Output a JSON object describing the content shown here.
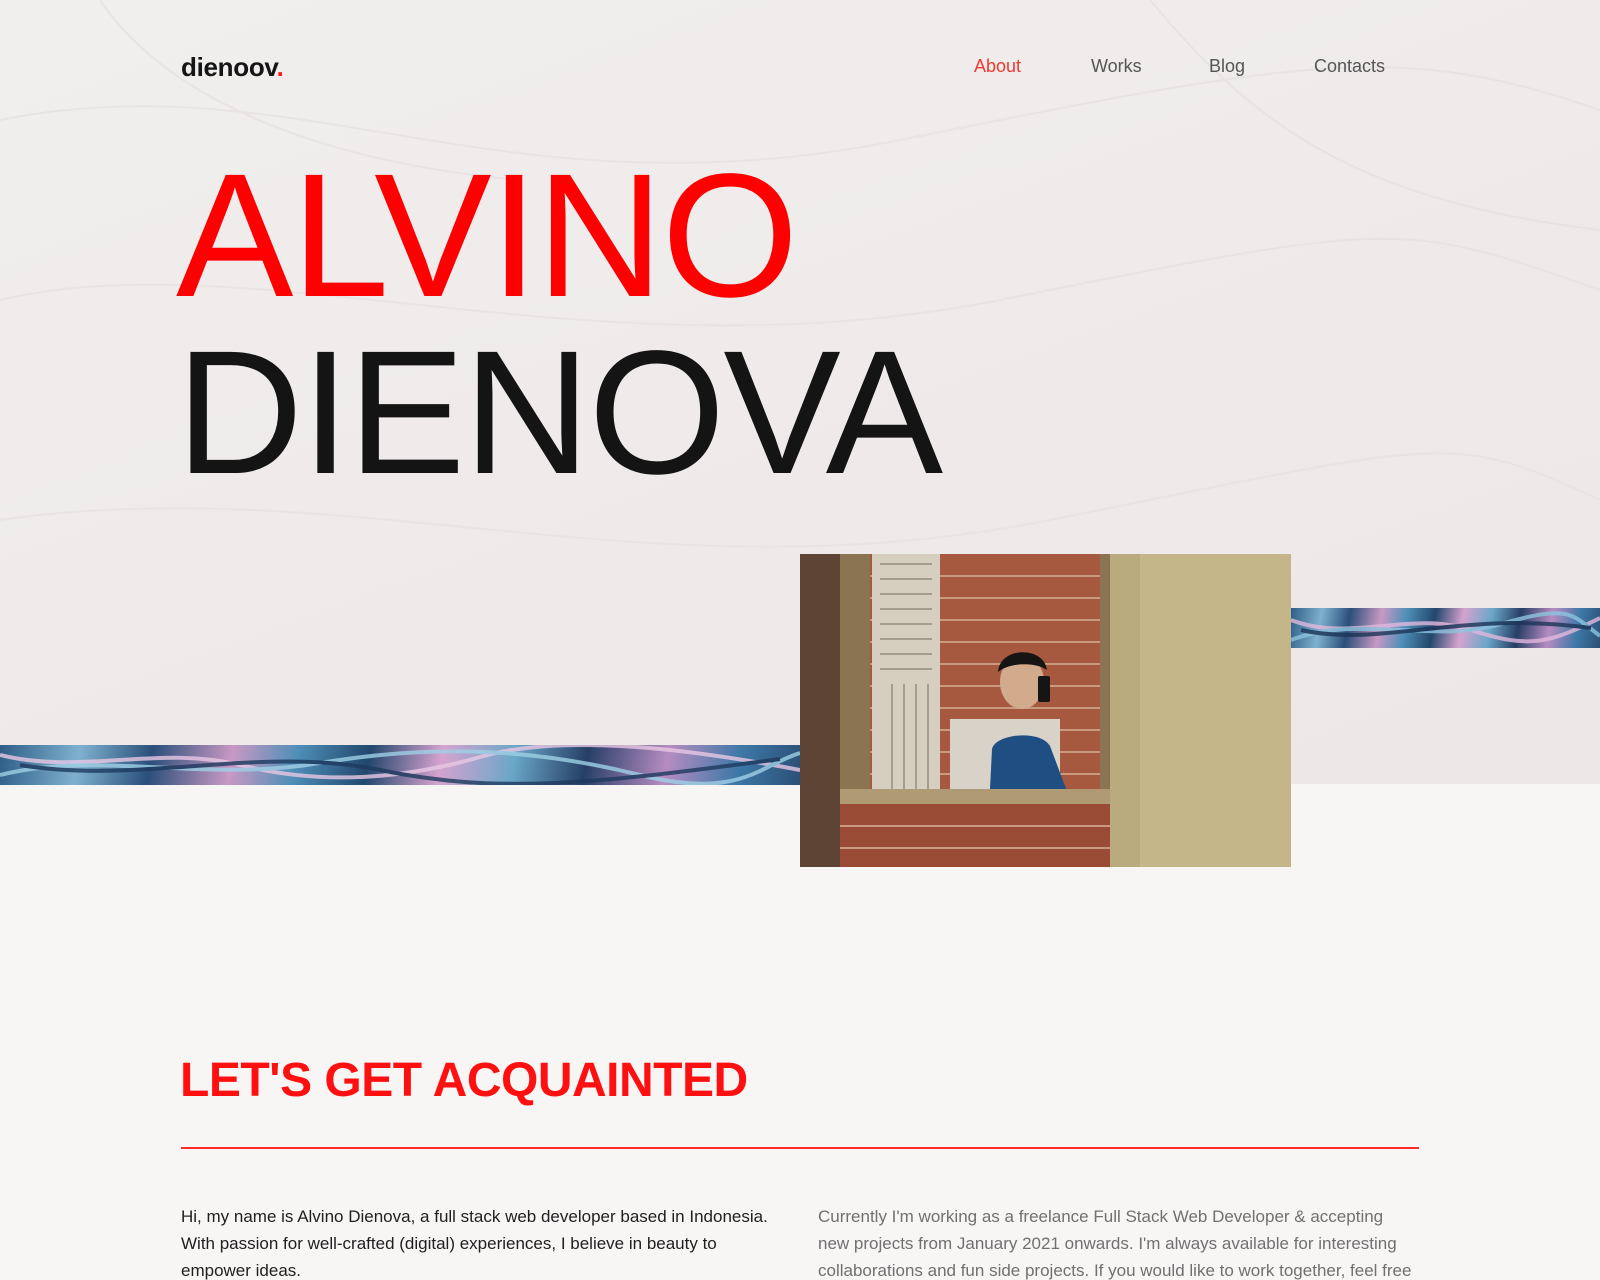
{
  "brand": {
    "name": "dienoov",
    "dot": "."
  },
  "nav": {
    "items": [
      {
        "label": "About",
        "active": true
      },
      {
        "label": "Works",
        "active": false
      },
      {
        "label": "Blog",
        "active": false
      },
      {
        "label": "Contacts",
        "active": false
      }
    ]
  },
  "hero": {
    "first_name": "ALVINO",
    "last_name": "DIENOVA"
  },
  "intro": {
    "title": "LET'S GET ACQUAINTED",
    "left_paragraph": "Hi, my name is Alvino Dienova, a full stack web developer based in Indonesia. With passion for well-crafted (digital) experiences, I believe in beauty to empower ideas.",
    "right_paragraph": "Currently I'm working as a freelance Full Stack Web Developer & accepting new projects from January 2021 onwards. I'm always available for interesting collaborations and fun side projects. If you would like to work together, feel free to"
  },
  "colors": {
    "accent": "#ff0000",
    "text": "#141414",
    "nav_text": "#555555"
  }
}
